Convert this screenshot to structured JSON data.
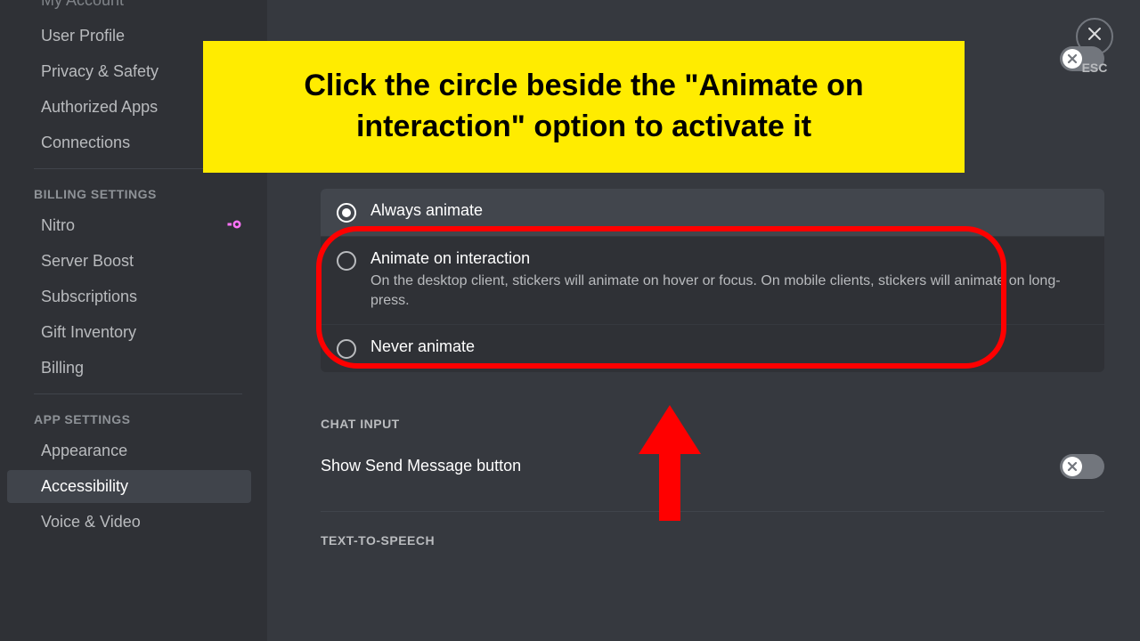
{
  "sidebar": {
    "user_settings": [
      "My Account",
      "User Profile",
      "Privacy & Safety",
      "Authorized Apps",
      "Connections"
    ],
    "billing_heading": "BILLING SETTINGS",
    "billing": [
      "Nitro",
      "Server Boost",
      "Subscriptions",
      "Gift Inventory",
      "Billing"
    ],
    "app_heading": "APP SETTINGS",
    "app": [
      "Appearance",
      "Accessibility",
      "Voice & Video"
    ]
  },
  "main": {
    "stickers": {
      "options": {
        "always": {
          "title": "Always animate"
        },
        "interaction": {
          "title": "Animate on interaction",
          "desc": "On the desktop client, stickers will animate on hover or focus. On mobile clients, stickers will animate on long-press."
        },
        "never": {
          "title": "Never animate"
        }
      }
    },
    "chat_input": {
      "heading": "CHAT INPUT",
      "show_send_label": "Show Send Message button"
    },
    "tts": {
      "heading": "TEXT-TO-SPEECH"
    }
  },
  "close": {
    "label": "ESC"
  },
  "annotation": {
    "callout": "Click the circle beside the \"Animate on interaction\" option to activate it"
  }
}
